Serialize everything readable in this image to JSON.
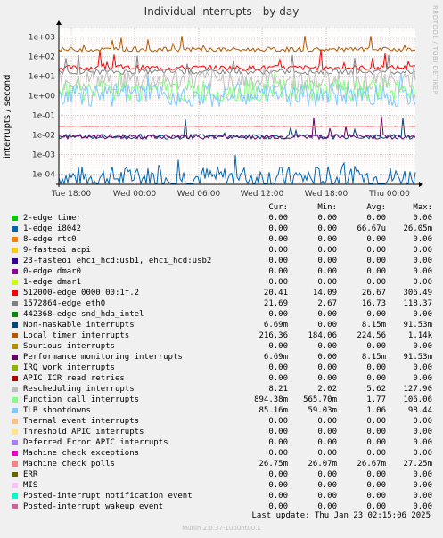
{
  "title": "Individual interrupts - by day",
  "side_text": "RRDTOOL / TOBI OETIKER",
  "footer": {
    "last_update": "Last update:  Thu Jan 23 02:15:06 2025",
    "munin": "Munin 2.0.37-1ubuntu0.1"
  },
  "legend_headers": {
    "cur": "Cur:",
    "min": "Min:",
    "avg": "Avg:",
    "max": "Max:"
  },
  "chart_data": {
    "type": "line",
    "title": "Individual interrupts - by day",
    "ylabel": "interrupts / second",
    "yscale": "log",
    "yticks": [
      "1e+03",
      "1e+02",
      "1e+01",
      "1e+00",
      "1e-01",
      "1e-02",
      "1e-03",
      "1e-04"
    ],
    "ytick_values": [
      1000,
      100,
      10,
      1,
      0.1,
      0.01,
      0.001,
      0.0001
    ],
    "ylim": [
      3e-05,
      3000
    ],
    "xticks": [
      "Tue 18:00",
      "Wed 00:00",
      "Wed 06:00",
      "Wed 12:00",
      "Wed 18:00",
      "Thu 00:00"
    ],
    "grid": true,
    "series": [
      {
        "name": "2-edge timer",
        "color": "#00cc00",
        "cur": "0.00",
        "min": "0.00",
        "avg": "0.00",
        "max": "0.00"
      },
      {
        "name": "1-edge i8042",
        "color": "#0066b3",
        "cur": "0.00",
        "min": "0.00",
        "avg": "66.67u",
        "max": "26.05m"
      },
      {
        "name": "8-edge rtc0",
        "color": "#ff8000",
        "cur": "0.00",
        "min": "0.00",
        "avg": "0.00",
        "max": "0.00"
      },
      {
        "name": "9-fasteoi acpi",
        "color": "#ffcc00",
        "cur": "0.00",
        "min": "0.00",
        "avg": "0.00",
        "max": "0.00"
      },
      {
        "name": "23-fasteoi ehci_hcd:usb1, ehci_hcd:usb2",
        "color": "#330099",
        "cur": "0.00",
        "min": "0.00",
        "avg": "0.00",
        "max": "0.00"
      },
      {
        "name": "0-edge dmar0",
        "color": "#990099",
        "cur": "0.00",
        "min": "0.00",
        "avg": "0.00",
        "max": "0.00"
      },
      {
        "name": "1-edge dmar1",
        "color": "#ccff00",
        "cur": "0.00",
        "min": "0.00",
        "avg": "0.00",
        "max": "0.00"
      },
      {
        "name": "512000-edge 0000:00:1f.2",
        "color": "#ff0000",
        "cur": "20.41",
        "min": "14.09",
        "avg": "26.67",
        "max": "306.49"
      },
      {
        "name": "1572864-edge eth0",
        "color": "#808080",
        "cur": "21.69",
        "min": "2.67",
        "avg": "16.73",
        "max": "118.37"
      },
      {
        "name": "442368-edge snd_hda_intel",
        "color": "#008f00",
        "cur": "0.00",
        "min": "0.00",
        "avg": "0.00",
        "max": "0.00"
      },
      {
        "name": "Non-maskable interrupts",
        "color": "#00487d",
        "cur": "6.69m",
        "min": "0.00",
        "avg": "8.15m",
        "max": "91.53m"
      },
      {
        "name": "Local timer interrupts",
        "color": "#b35a00",
        "cur": "216.36",
        "min": "184.06",
        "avg": "224.56",
        "max": "1.14k"
      },
      {
        "name": "Spurious interrupts",
        "color": "#b38f00",
        "cur": "0.00",
        "min": "0.00",
        "avg": "0.00",
        "max": "0.00"
      },
      {
        "name": "Performance monitoring interrupts",
        "color": "#6b006b",
        "cur": "6.69m",
        "min": "0.00",
        "avg": "8.15m",
        "max": "91.53m"
      },
      {
        "name": "IRQ work interrupts",
        "color": "#8fb300",
        "cur": "0.00",
        "min": "0.00",
        "avg": "0.00",
        "max": "0.00"
      },
      {
        "name": "APIC ICR read retries",
        "color": "#b30000",
        "cur": "0.00",
        "min": "0.00",
        "avg": "0.00",
        "max": "0.00"
      },
      {
        "name": "Rescheduling interrupts",
        "color": "#bebebe",
        "cur": "8.21",
        "min": "2.02",
        "avg": "5.62",
        "max": "127.90"
      },
      {
        "name": "Function call interrupts",
        "color": "#80ff80",
        "cur": "894.38m",
        "min": "565.70m",
        "avg": "1.77",
        "max": "106.06"
      },
      {
        "name": "TLB shootdowns",
        "color": "#80c9ff",
        "cur": "85.16m",
        "min": "59.03m",
        "avg": "1.06",
        "max": "98.44"
      },
      {
        "name": "Thermal event interrupts",
        "color": "#ffc080",
        "cur": "0.00",
        "min": "0.00",
        "avg": "0.00",
        "max": "0.00"
      },
      {
        "name": "Threshold APIC interrupts",
        "color": "#ffe680",
        "cur": "0.00",
        "min": "0.00",
        "avg": "0.00",
        "max": "0.00"
      },
      {
        "name": "Deferred Error APIC interrupts",
        "color": "#aa80ff",
        "cur": "0.00",
        "min": "0.00",
        "avg": "0.00",
        "max": "0.00"
      },
      {
        "name": "Machine check exceptions",
        "color": "#ee00cc",
        "cur": "0.00",
        "min": "0.00",
        "avg": "0.00",
        "max": "0.00"
      },
      {
        "name": "Machine check polls",
        "color": "#ff8080",
        "cur": "26.75m",
        "min": "26.07m",
        "avg": "26.67m",
        "max": "27.25m"
      },
      {
        "name": "ERR",
        "color": "#666600",
        "cur": "0.00",
        "min": "0.00",
        "avg": "0.00",
        "max": "0.00"
      },
      {
        "name": "MIS",
        "color": "#ffbfff",
        "cur": "0.00",
        "min": "0.00",
        "avg": "0.00",
        "max": "0.00"
      },
      {
        "name": "Posted-interrupt notification event",
        "color": "#00ffcc",
        "cur": "0.00",
        "min": "0.00",
        "avg": "0.00",
        "max": "0.00"
      },
      {
        "name": "Posted-interrupt wakeup event",
        "color": "#cc6699",
        "cur": "0.00",
        "min": "0.00",
        "avg": "0.00",
        "max": "0.00"
      }
    ]
  }
}
